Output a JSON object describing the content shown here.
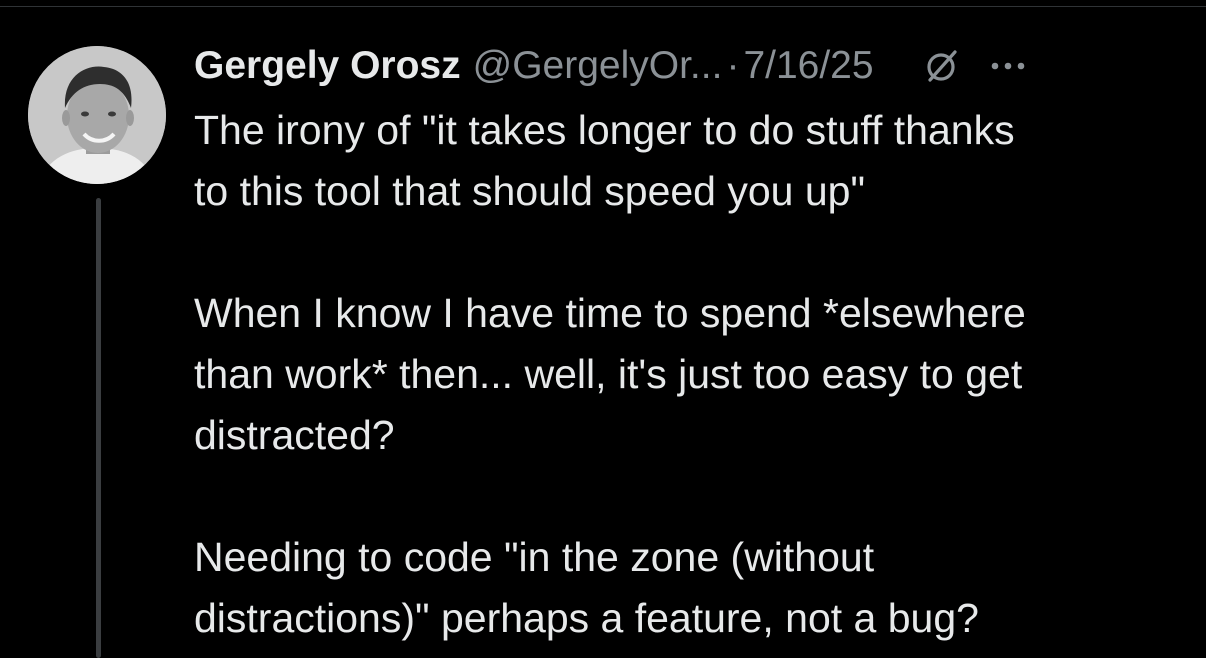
{
  "tweet": {
    "author_name": "Gergely Orosz",
    "author_handle": "@GergelyOr...",
    "separator": "·",
    "date": "7/16/25",
    "paragraphs": [
      "The irony of \"it takes longer to do stuff thanks\nto this tool that should speed you up\"",
      "When I know I have time to spend *elsewhere\nthan work* then... well, it's just too easy to get\ndistracted?",
      "Needing to code \"in the zone (without\ndistractions)\" perhaps a feature, not a bug?"
    ]
  },
  "icons": {
    "avatar": "user-avatar",
    "grok": "grok-icon",
    "more": "more-horizontal-icon"
  },
  "colors": {
    "background": "#000000",
    "text": "#e7e9ea",
    "secondary_text": "#8b9196",
    "thread_line": "#3a3d40"
  }
}
